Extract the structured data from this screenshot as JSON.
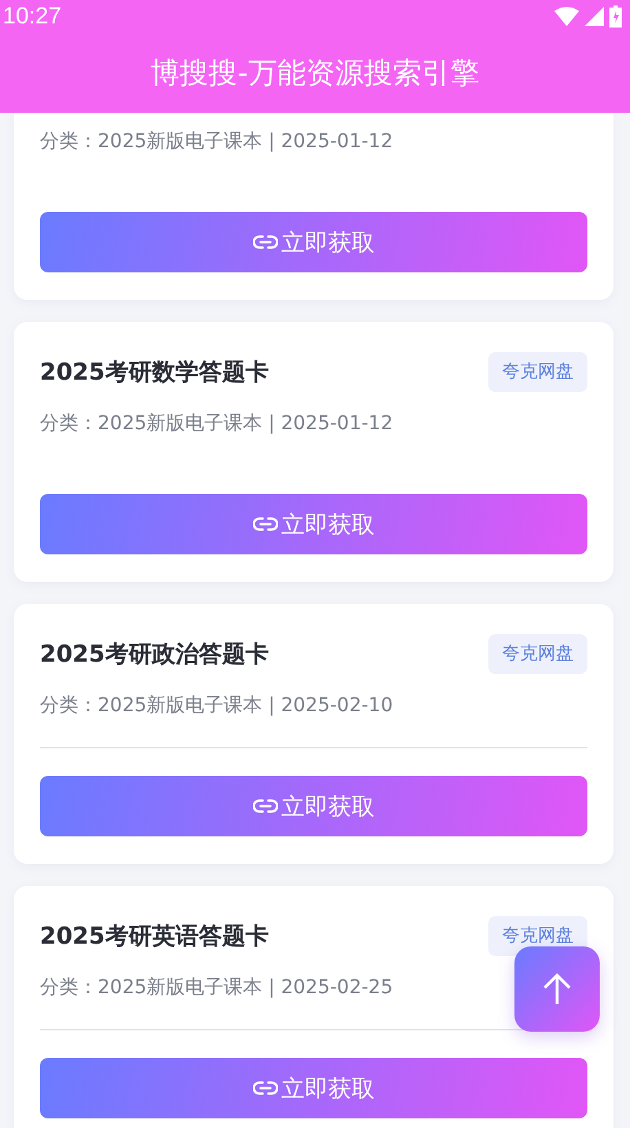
{
  "status_bar": {
    "time": "10:27"
  },
  "header": {
    "title": "博搜搜-万能资源搜索引擎"
  },
  "results": [
    {
      "meta": "分类：2025新版电子课本 | 2025-01-12",
      "button": "立即获取",
      "divider": false
    },
    {
      "title": "2025考研数学答题卡",
      "tag": "夸克网盘",
      "meta": "分类：2025新版电子课本 | 2025-01-12",
      "button": "立即获取",
      "divider": false
    },
    {
      "title": "2025考研政治答题卡",
      "tag": "夸克网盘",
      "meta": "分类：2025新版电子课本 | 2025-02-10",
      "button": "立即获取",
      "divider": true
    },
    {
      "title": "2025考研英语答题卡",
      "tag": "夸克网盘",
      "meta": "分类：2025新版电子课本 | 2025-02-25",
      "button": "立即获取",
      "divider": true
    }
  ]
}
